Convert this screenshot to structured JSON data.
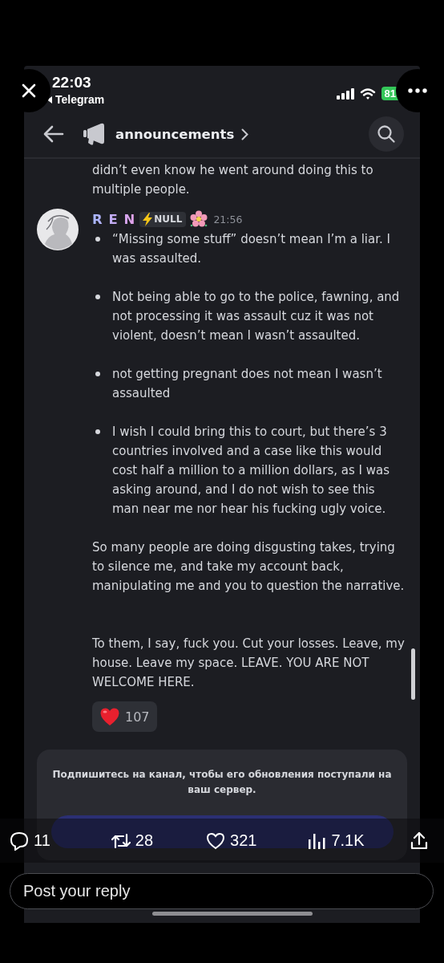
{
  "status_bar": {
    "time": "22:03",
    "back_app": "Telegram",
    "battery": "81"
  },
  "header": {
    "title": "announcements"
  },
  "previous_message_lines": [
    "didn’t even know he went around doing this to",
    "multiple people."
  ],
  "post": {
    "author": "R E N",
    "tag": "NULL",
    "time": "21:56",
    "bullets": [
      "“Missing some stuff” doesn’t mean I’m a liar. I was assaulted.",
      "Not being able to go to the police, fawning, and not processing it was assault cuz it was not violent, doesn’t mean I wasn’t assaulted.",
      "not getting pregnant does not mean I wasn’t assaulted",
      "I wish I could bring this to court, but there’s 3 countries involved and a case like this would cost half a million to a million dollars, as I was asking around, and I do not wish to see this man near me nor hear his fucking ugly voice."
    ],
    "paragraphs": [
      "So many people are doing disgusting takes, trying to silence me, and take my account back, manipulating me and you to question the narrative.",
      "To them, I say, fuck you. Cut your losses. Leave, my house. Leave my space. LEAVE. YOU ARE NOT WELCOME HERE."
    ],
    "reaction": {
      "count": "107"
    }
  },
  "subscribe": {
    "text": "Подпишитесь на канал, чтобы его обновления поступали на ваш сервер."
  },
  "tweet_actions": [
    {
      "kind": "reply",
      "count": "11"
    },
    {
      "kind": "repost",
      "count": "28"
    },
    {
      "kind": "like",
      "count": "321"
    },
    {
      "kind": "views",
      "count": "7.1K"
    },
    {
      "kind": "share"
    }
  ],
  "reply_field": {
    "placeholder": "Post your reply"
  }
}
